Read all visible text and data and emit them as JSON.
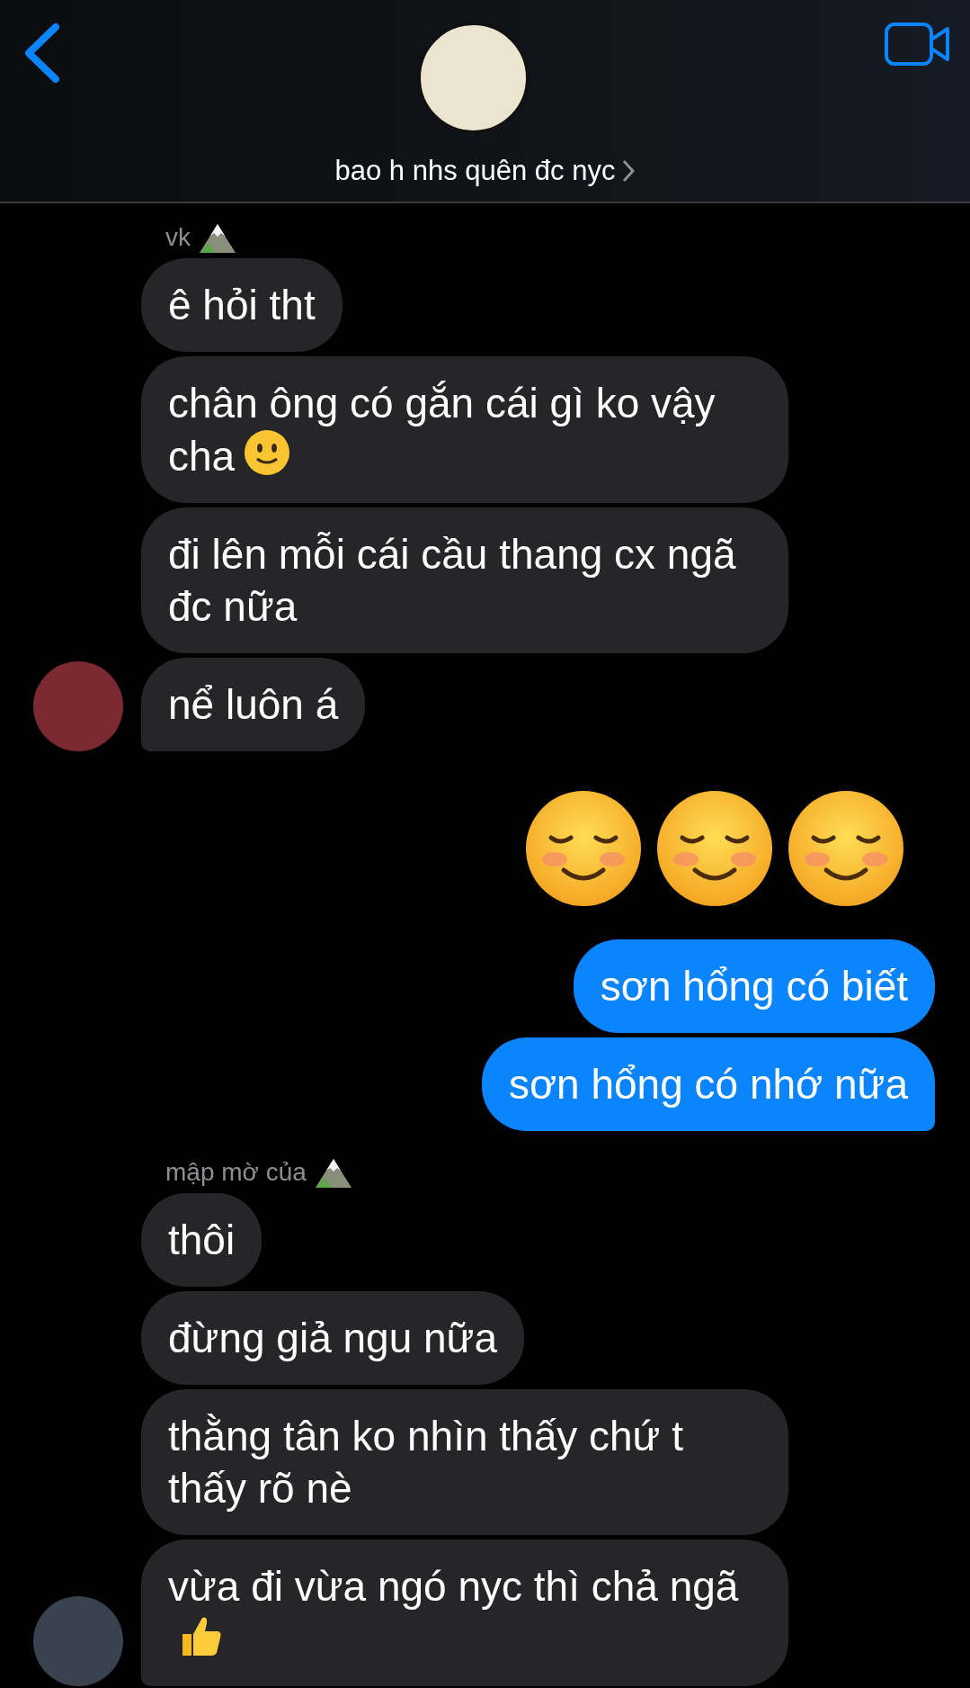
{
  "header": {
    "title": "bao h nhs quên đc nyc"
  },
  "groups": [
    {
      "kind": "incoming",
      "sender": "vk",
      "badge": {
        "kind": "mountain"
      },
      "messages": [
        {
          "text": "ê hỏi tht"
        },
        {
          "text": "chân ông có gắn cái gì ko vậy cha",
          "trailing": {
            "kind": "slight-smile"
          }
        },
        {
          "text": "đi lên mỗi cái cầu thang cx ngã đc nữa"
        },
        {
          "text": "nể luôn á"
        }
      ]
    },
    {
      "kind": "emoji",
      "emojis": [
        {
          "kind": "smiling"
        },
        {
          "kind": "smiling"
        },
        {
          "kind": "smiling"
        }
      ]
    },
    {
      "kind": "outgoing",
      "messages": [
        {
          "text": "sơn hổng có biết"
        },
        {
          "text": "sơn hổng có nhớ nữa"
        }
      ]
    },
    {
      "kind": "incoming",
      "sender": "mập mờ của",
      "badge": {
        "kind": "mountain"
      },
      "messages": [
        {
          "text": "thôi"
        },
        {
          "text": "đừng giả ngu nữa"
        },
        {
          "text": "thằng tân ko nhìn thấy chứ t thấy rõ nè"
        },
        {
          "text": "vừa đi vừa ngó nyc thì chả ngã",
          "trailing": {
            "kind": "thumbs-up"
          }
        }
      ]
    }
  ]
}
